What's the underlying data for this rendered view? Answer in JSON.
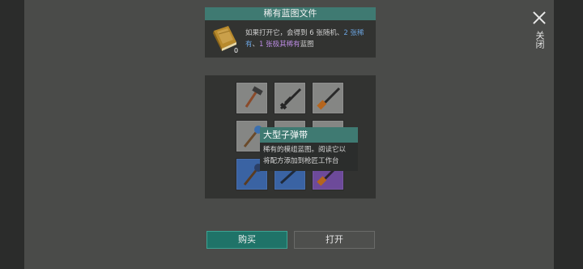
{
  "header": {
    "title": "稀有蓝图文件"
  },
  "close": {
    "label": "关闭",
    "icon": "close-icon"
  },
  "item_info": {
    "icon": "blueprint-book-icon",
    "count": "0",
    "desc_part1": "如果打开它，会得到 6 张随机、",
    "desc_rare": "2 张稀有",
    "desc_part2": "、",
    "desc_epic": "1 张极其稀有",
    "desc_part3": "蓝图"
  },
  "grid": {
    "items": [
      {
        "tier": "common",
        "icon": "hammer-icon"
      },
      {
        "tier": "common",
        "icon": "rifle-icon"
      },
      {
        "tier": "common",
        "icon": "shotgun-icon"
      },
      {
        "tier": "common",
        "icon": "mace-icon"
      },
      {
        "tier": "common",
        "icon": "gun-icon"
      },
      {
        "tier": "common",
        "icon": "gun-icon"
      },
      {
        "tier": "rare",
        "icon": "mace-icon"
      },
      {
        "tier": "rare",
        "icon": "gun-icon"
      },
      {
        "tier": "epic",
        "icon": "shotgun-icon"
      }
    ]
  },
  "tooltip": {
    "title": "大型子弹带",
    "line1": "稀有的模组蓝图。阅读它以",
    "line2": "将配方添加到枪匠工作台"
  },
  "buttons": {
    "buy": "购买",
    "open": "打开"
  },
  "colors": {
    "accent": "#3f7a72",
    "buy_button": "#1f7368",
    "rare_text": "#6aa2dd",
    "epic_text": "#b98ae0",
    "tier_common": "#858684",
    "tier_rare": "#3a63a3",
    "tier_epic": "#6d4a9a"
  }
}
